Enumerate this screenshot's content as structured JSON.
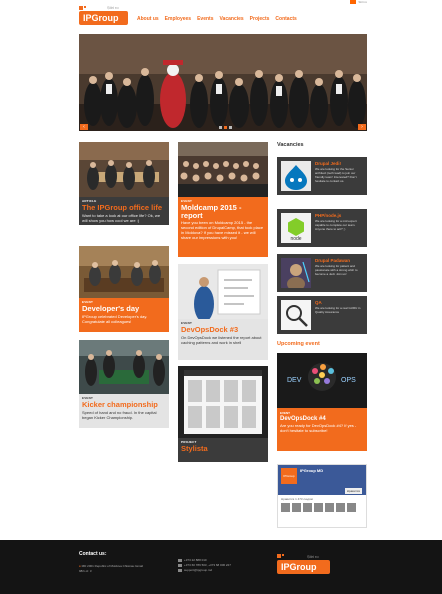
{
  "header": {
    "lang_switch": "Stiri ro",
    "logo_text": "IPGroup",
    "logo_lang": "Știri ro",
    "nav": [
      "About us",
      "Employees",
      "Events",
      "Vacancies",
      "Projects",
      "Contacts"
    ]
  },
  "hero": {
    "slides": 3,
    "active_slide": 1
  },
  "cards": [
    {
      "tag": "ARTICLE",
      "title": "The IPGroup office life",
      "text": "Want to take a look at our office life? Ok, we will show you how cool we are :)"
    },
    {
      "tag": "EVENT",
      "title": "Developer's day",
      "text": "IPGroup celebrated Developer's day. Congratulate all colleagues!"
    },
    {
      "tag": "EVENT",
      "title": "Kicker championship",
      "text": "Speed of hand and no fraud. In the capital began Kicker Championship."
    },
    {
      "tag": "EVENT",
      "title": "Moldcamp 2015 - report",
      "text": "Have you been on Moldcamp 2015 - the second edition of DrupalCamp, that took place in Moldova? If you have missed it - we will share our impressions with you!"
    },
    {
      "tag": "EVENT",
      "title": "DevOpsDock #3",
      "text": "On DevOpsDock we listened the report about caching patterns and work in shell"
    },
    {
      "tag": "PROJECT",
      "title": "Stylista",
      "text": ""
    }
  ],
  "vacancies": {
    "heading": "Vacancies",
    "items": [
      {
        "title": "Drupal Jedi!",
        "desc": "We are looking for the Senior architect (tech lead) to join our friendly team! Interested? Don't hesitate to contact us."
      },
      {
        "title": "PHP/node.js",
        "desc": "We are looking for a mid expert capable to complete our team. Anyone there to act? ;)"
      },
      {
        "title": "Drupal Padawan",
        "desc": "We are looking for patient and passionate with a strong wish to become a Jedi. Join us!"
      },
      {
        "title": "QA",
        "desc": "We are looking for a real GURU in Quality Assurance"
      }
    ]
  },
  "upcoming": {
    "heading": "Upcoming event",
    "image_text_left": "DEV",
    "image_text_right": "OPS",
    "tag": "EVENT",
    "title": "DevOpsDock #4",
    "text": "Are you ready for DevOpsDock #4? If yes - don't hesitate to subscribe!"
  },
  "facebook": {
    "page_name": "IPGroup MD",
    "like_label": "Нравится",
    "status": "Нравится 1 473 людям",
    "logo_text": "IPGroup"
  },
  "footer": {
    "contact_heading": "Contact us:",
    "address": "MD 2001 Republic of Moldova Chisinau Ismail 98/1 of. 3",
    "phone1": "+373 22 888 010",
    "phone2": "+373 60 789 503, +373 68 006 227",
    "email": "support@ipgroup.md",
    "logo_text": "IPGroup",
    "logo_lang": "Știri ro"
  },
  "colors": {
    "accent": "#f26b1d",
    "dark": "#3b3b3b",
    "footer": "#141414"
  }
}
